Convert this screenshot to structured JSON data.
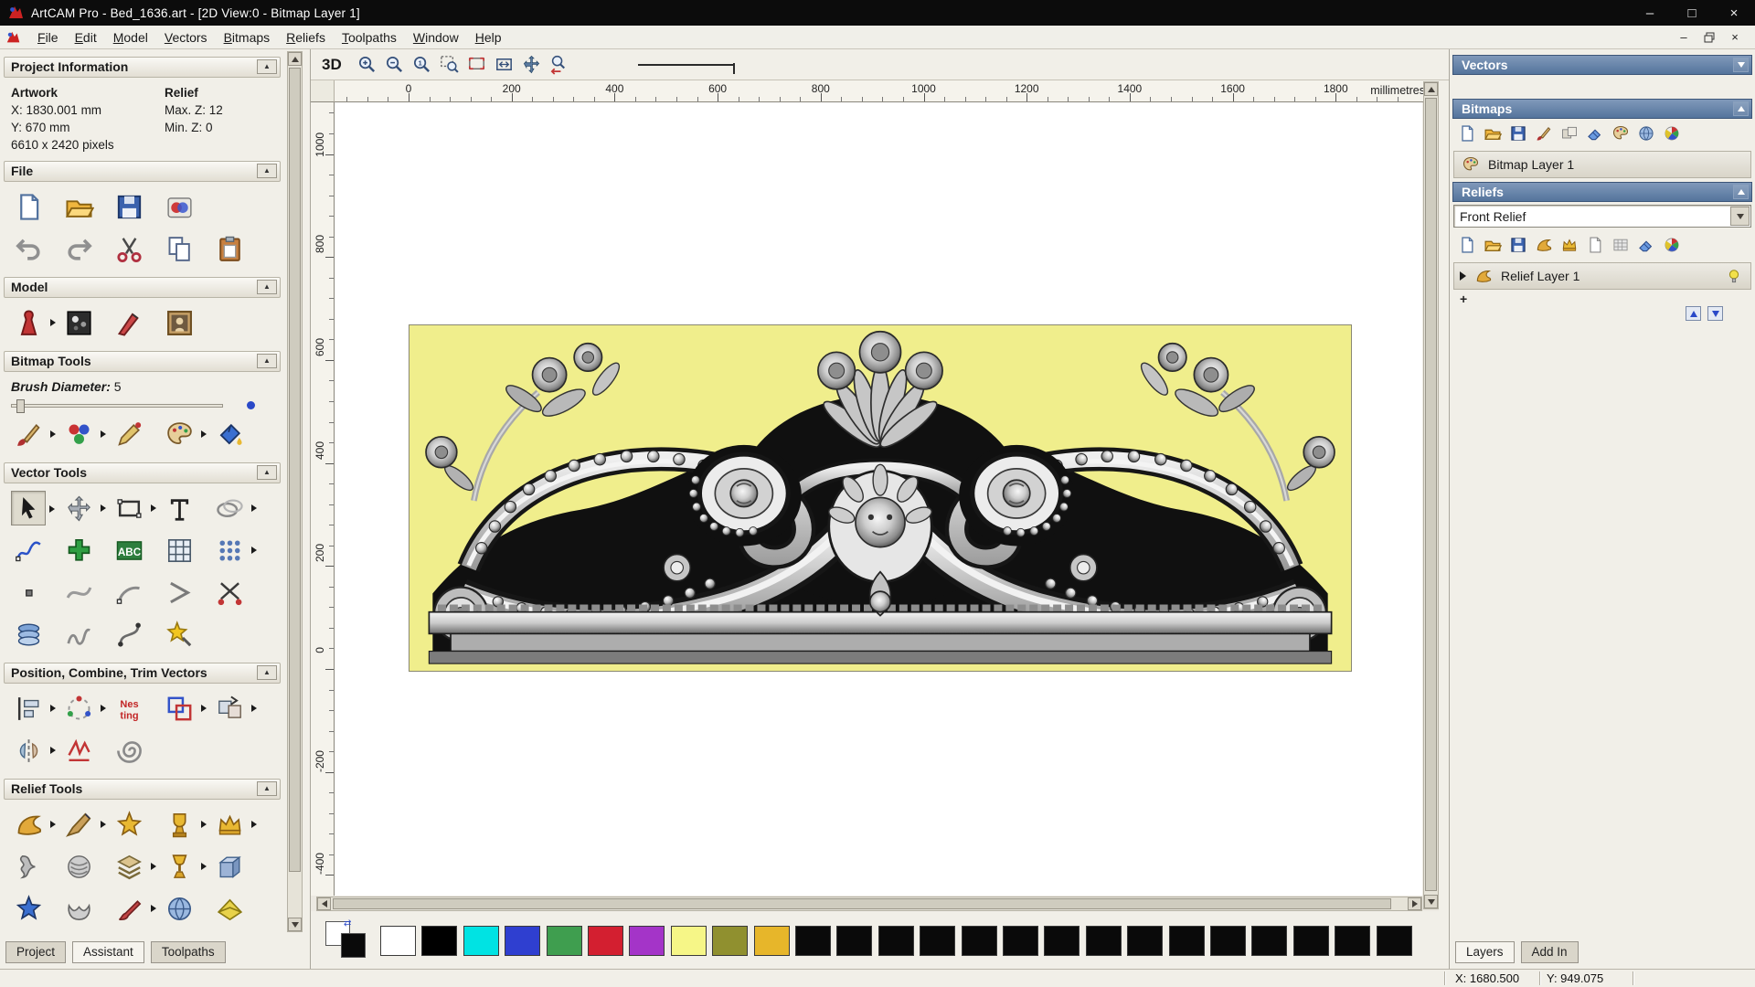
{
  "titlebar": {
    "title": "ArtCAM Pro - Bed_1636.art - [2D View:0 - Bitmap Layer 1]",
    "minimize": "–",
    "maximize": "□",
    "close": "×"
  },
  "menubar": {
    "items": [
      "File",
      "Edit",
      "Model",
      "Vectors",
      "Bitmaps",
      "Reliefs",
      "Toolpaths",
      "Window",
      "Help"
    ],
    "mdi_minimize": "–",
    "mdi_close": "×"
  },
  "left_panel": {
    "project_information": {
      "header": "Project Information",
      "artwork_title": "Artwork",
      "artwork_x": "X: 1830.001 mm",
      "artwork_y": "Y: 670 mm",
      "artwork_pixels": "6610 x 2420 pixels",
      "relief_title": "Relief",
      "relief_max": "Max. Z: 12",
      "relief_min": "Min. Z: 0"
    },
    "sections": [
      {
        "header": "File",
        "rows": [
          [
            "new-file",
            "open-file",
            "save-file",
            "import-model"
          ],
          [
            "undo",
            "redo",
            "cut",
            "copy",
            "paste"
          ]
        ]
      },
      {
        "header": "Model",
        "rows": [
          [
            "model-preview*",
            "greyscale-view",
            "sculpt",
            "load-picture"
          ]
        ]
      },
      {
        "header": "Bitmap Tools",
        "brush": {
          "label": "Brush Diameter:",
          "value": "5"
        },
        "rows": [
          [
            "paint-brush*",
            "flood-fill*",
            "pixel-pencil",
            "colour-palette*",
            "paint-bucket"
          ]
        ]
      },
      {
        "header": "Vector Tools",
        "rows": [
          [
            "select*",
            "transform*",
            "rectangle*",
            "text",
            "ellipse*"
          ],
          [
            "polyline",
            "node-edit",
            "vector-text",
            "grid",
            "array*"
          ],
          [
            "point",
            "bezier",
            "arc",
            "polygon",
            "trim"
          ],
          [
            "rings",
            "freehand",
            "curve",
            "magic-wand"
          ]
        ]
      },
      {
        "header": "Position, Combine, Trim Vectors",
        "rows": [
          [
            "align*",
            "rotate-copy*",
            "nesting",
            "group*",
            "weld*"
          ],
          [
            "mirror*",
            "hatch",
            "spiral"
          ]
        ]
      },
      {
        "header": "Relief Tools",
        "rows": [
          [
            "shape-editor*",
            "carve*",
            "star-relief",
            "trophy*",
            "crown*"
          ],
          [
            "ribbon",
            "weave",
            "layers-stack*",
            "chalice*",
            "emboss"
          ],
          [
            "star-blue",
            "shell",
            "paint-relief*",
            "sphere",
            "envelope"
          ],
          [
            "dot-red",
            "mesh",
            "ball-blue",
            "swirl-teal"
          ]
        ]
      }
    ],
    "tabs": [
      {
        "label": "Project",
        "active": false
      },
      {
        "label": "Assistant",
        "active": true
      },
      {
        "label": "Toolpaths",
        "active": false
      }
    ]
  },
  "toolbar": {
    "view_button": "3D",
    "tools": [
      "zoom-in",
      "zoom-out",
      "zoom-scale",
      "zoom-window",
      "zoom-object",
      "zoom-fit",
      "pan-view",
      "zoom-previous"
    ]
  },
  "ruler": {
    "unit": "millimetres",
    "h_ticks": [
      "0",
      "200",
      "400",
      "600",
      "800",
      "1000",
      "1200",
      "1400",
      "1600",
      "1800"
    ],
    "v_ticks": [
      "1000",
      "800",
      "600",
      "400",
      "200",
      "0",
      "-200",
      "-400"
    ]
  },
  "artwork": {
    "background": "#f0ee8c"
  },
  "palette": {
    "colors": [
      "#ffffff",
      "#000000",
      "#00e3e3",
      "#2f3fd0",
      "#3f9e4f",
      "#d31f30",
      "#a434c8",
      "#f6f687",
      "#90902f",
      "#e7b62a",
      "#0a0a0a",
      "#0a0a0a",
      "#0a0a0a",
      "#0a0a0a",
      "#0a0a0a",
      "#0a0a0a",
      "#0a0a0a",
      "#0a0a0a",
      "#0a0a0a",
      "#0a0a0a",
      "#0a0a0a",
      "#0a0a0a",
      "#0a0a0a",
      "#0a0a0a",
      "#0a0a0a"
    ]
  },
  "right_panel": {
    "vectors": {
      "header": "Vectors"
    },
    "bitmaps": {
      "header": "Bitmaps",
      "tools": [
        "new-file",
        "open-file",
        "save-file",
        "paint-brush",
        "merge",
        "eraser-blue",
        "colour-palette",
        "sphere",
        "color-wheel"
      ],
      "layers": [
        {
          "name": "Bitmap Layer 1"
        }
      ]
    },
    "reliefs": {
      "header": "Reliefs",
      "selected": "Front Relief",
      "tools": [
        "new-file",
        "open-file",
        "save-file",
        "shape-editor",
        "crown",
        "page-plain",
        "mesh",
        "eraser-blue",
        "color-wheel"
      ],
      "layers": [
        {
          "name": "Relief Layer 1"
        }
      ]
    },
    "tabs": [
      {
        "label": "Layers",
        "active": true
      },
      {
        "label": "Add In",
        "active": false
      }
    ]
  },
  "statusbar": {
    "x": "X: 1680.500",
    "y": "Y: 949.075"
  }
}
